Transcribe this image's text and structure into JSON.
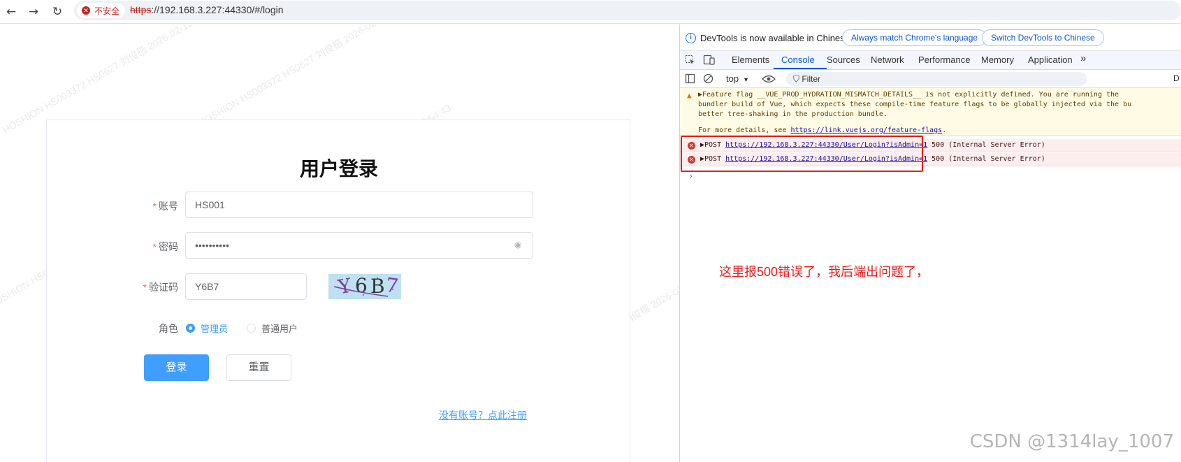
{
  "browser": {
    "back_icon": "←",
    "forward_icon": "→",
    "reload_icon": "↻",
    "security_label": "不安全",
    "url_protocol": "https",
    "url_rest": "://192.168.3.227:44330/#/login"
  },
  "watermark": {
    "lines": [
      "HOSHION HS003372 HS0627 刘俊楷 2026-02-11 10:54:43",
      "HOSHION HS003372 HS0627 刘俊楷 2026-02-11 10:54:43",
      "HOSHION HS003372 HS0627 刘俊楷 2026-02-11 10:54:43",
      "HOSHION HS003372 HS0627 刘俊楷 2026-02-11 10:54:43",
      "HOSHION HS003372 HS0627 刘俊楷 2026-02-11 10:54:43",
      "HOSHION HS003372 HS0627 刘俊楷 2026-02-11 10:54:43"
    ]
  },
  "login": {
    "title": "用户登录",
    "account_label": "账号",
    "account_value": "HS001",
    "password_label": "密码",
    "password_value": "••••••••••",
    "captcha_label": "验证码",
    "captcha_input_value": "Y6B7",
    "captcha_chars": [
      "Y",
      "6",
      "B",
      "7"
    ],
    "role_label": "角色",
    "role_admin": "管理员",
    "role_user": "普通用户",
    "role_selected": "管理员",
    "login_button": "登录",
    "reset_button": "重置",
    "register_link": "没有账号？点此注册"
  },
  "devtools": {
    "info_text": "DevTools is now available in Chinese!",
    "match_button": "Always match Chrome's language",
    "switch_button": "Switch DevTools to Chinese",
    "tabs": [
      "Elements",
      "Console",
      "Sources",
      "Network",
      "Performance",
      "Memory",
      "Application"
    ],
    "active_tab": "Console",
    "more_tabs_icon": "»",
    "context": "top",
    "filter_placeholder": "Filter",
    "filter_trailing": "D",
    "warning": {
      "line1": "▶Feature flag __VUE_PROD_HYDRATION_MISMATCH_DETAILS__ is not explicitly defined. You are running the",
      "line2": "bundler build of Vue, which expects these compile-time feature flags to be globally injected via the bu",
      "line3": "better tree-shaking in the production bundle.",
      "line4_prefix": "For more details, see ",
      "line4_link": "https://link.vuejs.org/feature-flags",
      "line4_suffix": "."
    },
    "errors": [
      {
        "method": "▶POST",
        "url": "https://192.168.3.227:44330/User/Login?isAdmin=1",
        "status": "500 (Internal Server Error)"
      },
      {
        "method": "▶POST",
        "url": "https://192.168.3.227:44330/User/Login?isAdmin=1",
        "status": "500 (Internal Server Error)"
      }
    ],
    "prompt_symbol": "›",
    "annotation": "这里报500错误了，我后端出问题了，",
    "colors": {
      "annotation": "#e81c1c",
      "accent": "#409eff",
      "error": "#dc362e"
    }
  },
  "csdn_watermark": "CSDN @1314lay_1007"
}
